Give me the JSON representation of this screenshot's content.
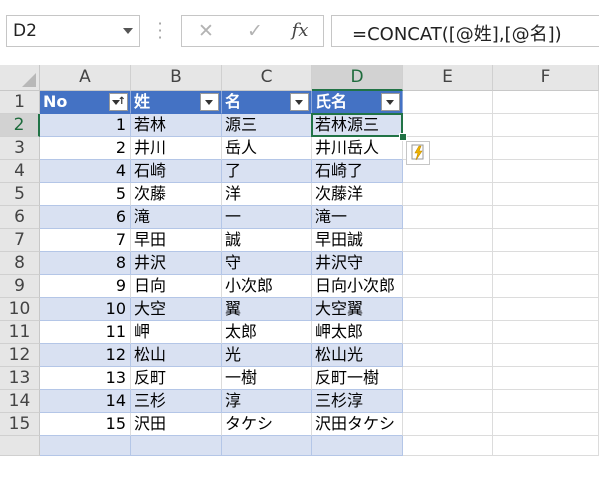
{
  "formula_bar": {
    "name_box": "D2",
    "cancel_icon": "close-icon",
    "enter_icon": "check-icon",
    "fx_label": "fx",
    "formula": "=CONCAT([@姓],[@名])"
  },
  "columns": [
    "A",
    "B",
    "C",
    "D",
    "E",
    "F"
  ],
  "selected_column": "D",
  "rows": [
    "1",
    "2",
    "3",
    "4",
    "5",
    "6",
    "7",
    "8",
    "9",
    "10",
    "11",
    "12",
    "13",
    "14",
    "15"
  ],
  "selected_row": "2",
  "table": {
    "headers": [
      "No",
      "姓",
      "名",
      "氏名"
    ],
    "sorted_column": "No",
    "rows": [
      [
        "1",
        "若林",
        "源三",
        "若林源三"
      ],
      [
        "2",
        "井川",
        "岳人",
        "井川岳人"
      ],
      [
        "4",
        "石崎",
        "了",
        "石崎了"
      ],
      [
        "5",
        "次藤",
        "洋",
        "次藤洋"
      ],
      [
        "6",
        "滝",
        "一",
        "滝一"
      ],
      [
        "7",
        "早田",
        "誠",
        "早田誠"
      ],
      [
        "8",
        "井沢",
        "守",
        "井沢守"
      ],
      [
        "9",
        "日向",
        "小次郎",
        "日向小次郎"
      ],
      [
        "10",
        "大空",
        "翼",
        "大空翼"
      ],
      [
        "11",
        "岬",
        "太郎",
        "岬太郎"
      ],
      [
        "12",
        "松山",
        "光",
        "松山光"
      ],
      [
        "13",
        "反町",
        "一樹",
        "反町一樹"
      ],
      [
        "14",
        "三杉",
        "淳",
        "三杉淳"
      ],
      [
        "15",
        "沢田",
        "タケシ",
        "沢田タケシ"
      ]
    ]
  },
  "active_cell": "D2",
  "autofill_options_icon": "flash-fill-icon",
  "colors": {
    "header_fill": "#4472c4",
    "band_fill": "#d9e1f2",
    "selection_green": "#217346",
    "flash_icon": "#f0b400"
  }
}
